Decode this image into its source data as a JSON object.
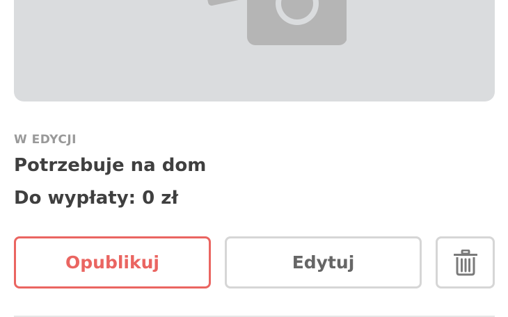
{
  "card": {
    "image": {
      "icon": "camera-icon"
    },
    "status": "W EDYCJI",
    "title": "Potrzebuje na dom",
    "payout": "Do wypłaty: 0 zł"
  },
  "actions": {
    "publish_label": "Opublikuj",
    "edit_label": "Edytuj",
    "delete_icon": "trash-icon"
  },
  "colors": {
    "accent": "#ea6561",
    "placeholder_bg": "#dadcde",
    "placeholder_icon": "#b5b5b5",
    "border_neutral": "#d6d6d6",
    "text_primary": "#3f3f3f",
    "text_muted": "#999999"
  }
}
